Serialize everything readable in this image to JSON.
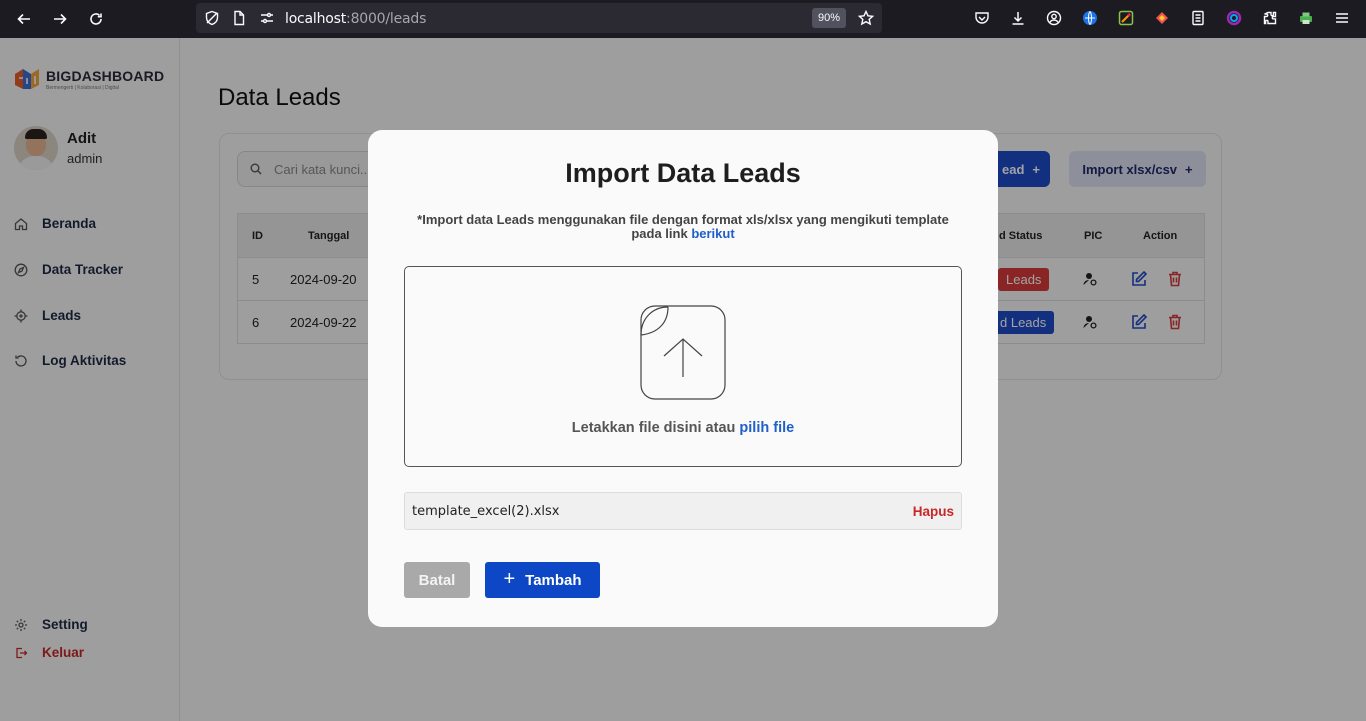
{
  "browser": {
    "url_host": "localhost",
    "url_rest": ":8000/leads",
    "zoom": "90%"
  },
  "brand": {
    "name": "BIGDASHBOARD",
    "tagline": "Bermengerti | Kolaborasi | Digital"
  },
  "profile": {
    "name": "Adit",
    "role": "admin"
  },
  "nav": {
    "beranda": "Beranda",
    "data_tracker": "Data Tracker",
    "leads": "Leads",
    "log": "Log Aktivitas",
    "setting": "Setting",
    "logout": "Keluar"
  },
  "main": {
    "title": "Data Leads",
    "search_placeholder": "Cari kata kunci...",
    "add_lead_label": "ead",
    "import_label": "Import xlsx/csv",
    "columns": {
      "id": "ID",
      "date": "Tanggal",
      "status": "d Status",
      "pic": "PIC",
      "action": "Action"
    },
    "rows": [
      {
        "id": "5",
        "date": "2024-09-20",
        "status": "Leads"
      },
      {
        "id": "6",
        "date": "2024-09-22",
        "status": "d Leads"
      }
    ]
  },
  "modal": {
    "title": "Import Data Leads",
    "desc": "*Import data Leads menggunakan file dengan format xls/xlsx yang mengikuti template pada link",
    "desc_link": "berikut",
    "drop_text": "Letakkan file disini atau",
    "drop_link": "pilih file",
    "file_name": "template_excel(2).xlsx",
    "delete_label": "Hapus",
    "cancel_label": "Batal",
    "submit_label": "Tambah"
  },
  "colors": {
    "primary": "#0d47c5",
    "danger": "#c62828",
    "link": "#1f5fc9"
  }
}
